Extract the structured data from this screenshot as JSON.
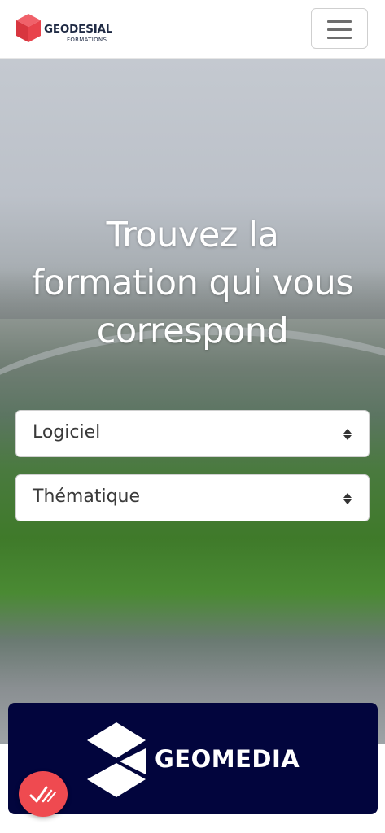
{
  "header": {
    "logo_name": "GEODESIAL",
    "logo_sub": "FORMATIONS",
    "logo_icon": "cube-icon",
    "menu_icon": "hamburger-icon"
  },
  "hero": {
    "title_line1": "Trouvez la",
    "title_line2": "formation qui vous",
    "title_line3": "correspond"
  },
  "filters": {
    "software_selected": "Logiciel",
    "theme_selected": "Thématique"
  },
  "brand_card": {
    "name": "GEOMEDIA",
    "icon": "geomedia-logo-icon",
    "background": "#02053d"
  },
  "fab": {
    "icon": "check-marks-icon",
    "color": "#ef4a50"
  },
  "colors": {
    "brand_red": "#e8434c",
    "text_dark": "#1f2a44"
  }
}
